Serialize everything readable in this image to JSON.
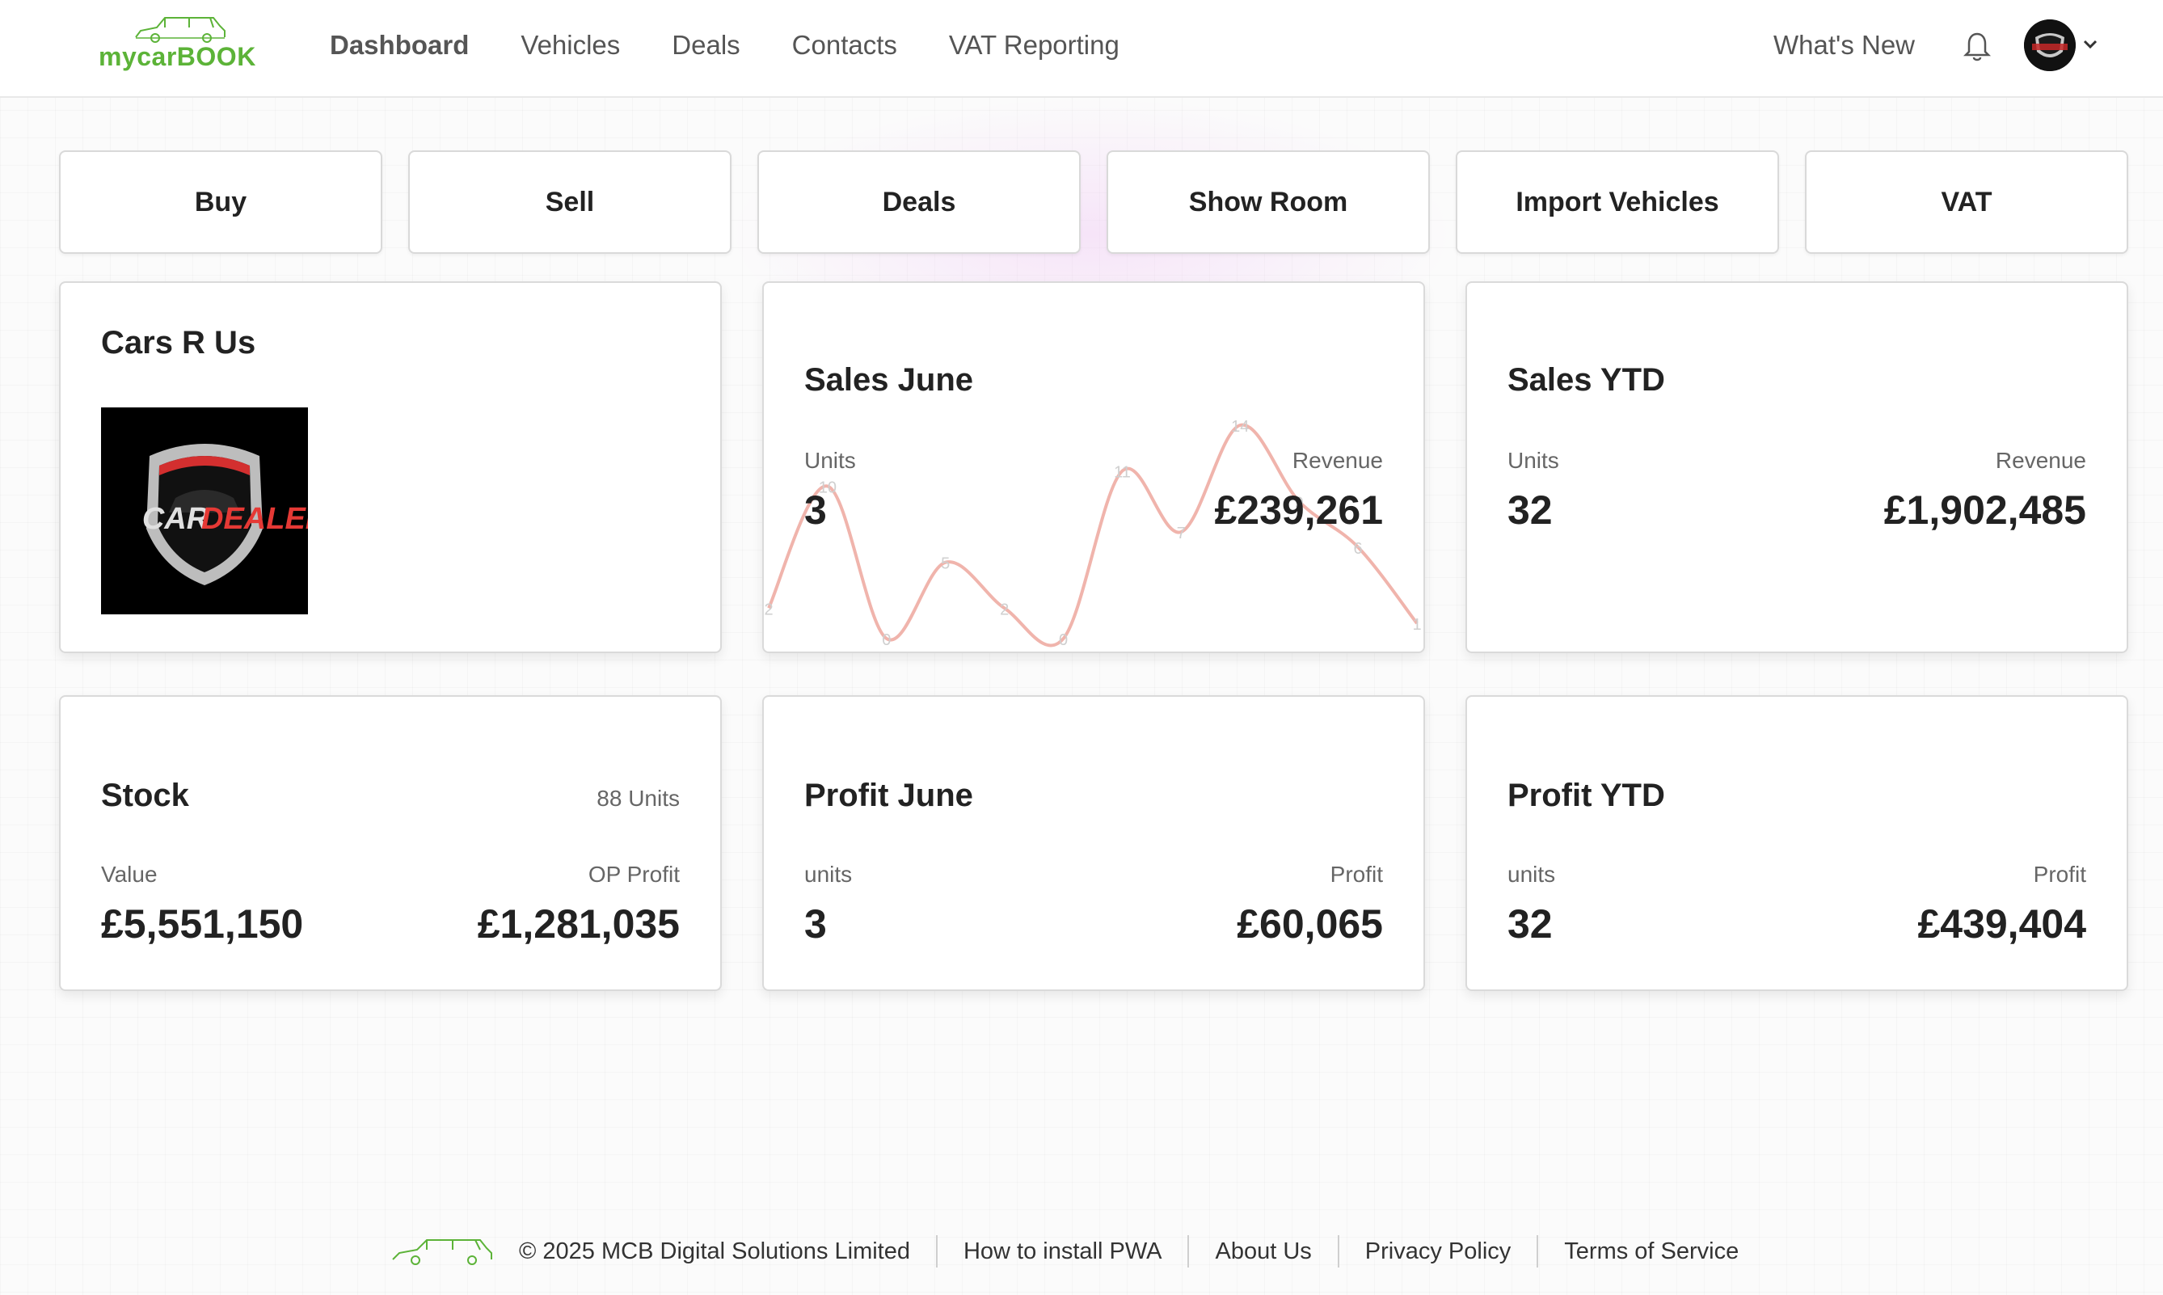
{
  "app": {
    "logo_text": "mycarBOOK",
    "accent": "#5cb338"
  },
  "nav": {
    "items": [
      "Dashboard",
      "Vehicles",
      "Deals",
      "Contacts",
      "VAT Reporting"
    ],
    "whats_new": "What's New"
  },
  "actions": [
    "Buy",
    "Sell",
    "Deals",
    "Show Room",
    "Import Vehicles",
    "VAT"
  ],
  "dealer": {
    "name": "Cars R Us",
    "logo_text": "CAR DEALER"
  },
  "sales_june": {
    "title": "Sales June",
    "units_label": "Units",
    "units": "3",
    "revenue_label": "Revenue",
    "revenue": "£239,261"
  },
  "sales_ytd": {
    "title": "Sales YTD",
    "units_label": "Units",
    "units": "32",
    "revenue_label": "Revenue",
    "revenue": "£1,902,485"
  },
  "stock": {
    "title": "Stock",
    "count": "88 Units",
    "value_label": "Value",
    "value": "£5,551,150",
    "op_profit_label": "OP Profit",
    "op_profit": "£1,281,035"
  },
  "profit_june": {
    "title": "Profit June",
    "units_label": "units",
    "units": "3",
    "profit_label": "Profit",
    "profit": "£60,065"
  },
  "profit_ytd": {
    "title": "Profit YTD",
    "units_label": "units",
    "units": "32",
    "profit_label": "Profit",
    "profit": "£439,404"
  },
  "chart_data": {
    "type": "line",
    "x": [
      1,
      2,
      3,
      4,
      5,
      6,
      7,
      8,
      9,
      10,
      11,
      12
    ],
    "values": [
      2,
      10,
      0,
      5,
      2,
      0,
      11,
      7,
      14,
      9,
      6,
      1
    ],
    "color": "#f0b4ac",
    "grid": false
  },
  "footer": {
    "copyright": "© 2025 MCB Digital Solutions Limited",
    "links": [
      "How to install PWA",
      "About Us",
      "Privacy Policy",
      "Terms of Service"
    ]
  }
}
